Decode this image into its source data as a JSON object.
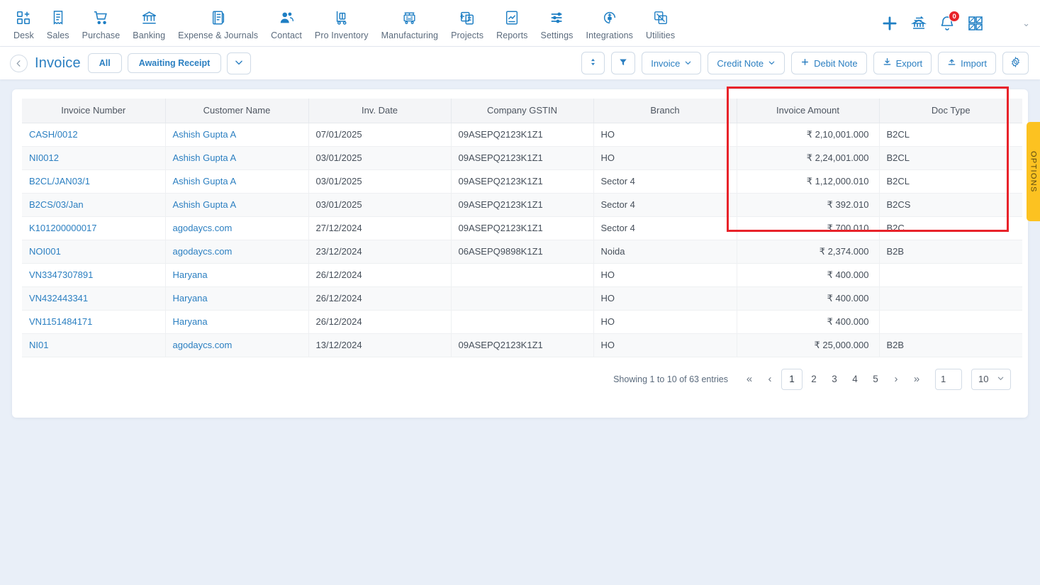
{
  "topnav": {
    "modules": [
      {
        "label": "Desk",
        "icon": "dashboard-grid-plus-icon"
      },
      {
        "label": "Sales",
        "icon": "receipt-icon"
      },
      {
        "label": "Purchase",
        "icon": "shopping-cart-icon"
      },
      {
        "label": "Banking",
        "icon": "bank-building-icon"
      },
      {
        "label": "Expense & Journals",
        "icon": "ledger-book-icon"
      },
      {
        "label": "Contact",
        "icon": "people-icon"
      },
      {
        "label": "Pro Inventory",
        "icon": "hand-truck-icon"
      },
      {
        "label": "Manufacturing",
        "icon": "factory-machine-icon"
      },
      {
        "label": "Projects",
        "icon": "project-clipboard-icon"
      },
      {
        "label": "Reports",
        "icon": "report-chart-icon"
      },
      {
        "label": "Settings",
        "icon": "sliders-icon"
      },
      {
        "label": "Integrations",
        "icon": "plug-circle-icon"
      },
      {
        "label": "Utilities",
        "icon": "utilities-swap-icon"
      }
    ],
    "actions": {
      "add": "add-plus-icon",
      "bank_transfer": "bank-transfer-icon",
      "notifications": "bell-icon",
      "notification_count": "0",
      "apps": "apps-grid-icon",
      "user_caret": "chevron-down-icon"
    }
  },
  "subheader": {
    "back": "chevron-left-icon",
    "title": "Invoice",
    "filter_all": "All",
    "filter_awaiting": "Awaiting Receipt",
    "filter_more": "chevron-down-icon",
    "sort_icon": "sort-updown-icon",
    "filter_icon": "funnel-icon",
    "invoice_dropdown": "Invoice",
    "credit_note_dropdown": "Credit Note",
    "debit_note": "Debit Note",
    "export": "Export",
    "import": "Import",
    "settings_icon": "gear-icon"
  },
  "table": {
    "columns": [
      "Invoice Number",
      "Customer Name",
      "Inv. Date",
      "Company GSTIN",
      "Branch",
      "Invoice Amount",
      "Doc Type"
    ],
    "rows": [
      {
        "invoice_number": "CASH/0012",
        "customer_name": "Ashish Gupta A",
        "inv_date": "07/01/2025",
        "company_gstin": "09ASEPQ2123K1Z1",
        "branch": "HO",
        "invoice_amount": "₹ 2,10,001.000",
        "doc_type": "B2CL"
      },
      {
        "invoice_number": "NI0012",
        "customer_name": "Ashish Gupta A",
        "inv_date": "03/01/2025",
        "company_gstin": "09ASEPQ2123K1Z1",
        "branch": "HO",
        "invoice_amount": "₹ 2,24,001.000",
        "doc_type": "B2CL"
      },
      {
        "invoice_number": "B2CL/JAN03/1",
        "customer_name": "Ashish Gupta A",
        "inv_date": "03/01/2025",
        "company_gstin": "09ASEPQ2123K1Z1",
        "branch": "Sector 4",
        "invoice_amount": "₹ 1,12,000.010",
        "doc_type": "B2CL"
      },
      {
        "invoice_number": "B2CS/03/Jan",
        "customer_name": "Ashish Gupta A",
        "inv_date": "03/01/2025",
        "company_gstin": "09ASEPQ2123K1Z1",
        "branch": "Sector 4",
        "invoice_amount": "₹ 392.010",
        "doc_type": "B2CS"
      },
      {
        "invoice_number": "K101200000017",
        "customer_name": "agodaycs.com",
        "inv_date": "27/12/2024",
        "company_gstin": "09ASEPQ2123K1Z1",
        "branch": "Sector 4",
        "invoice_amount": "₹ 700.010",
        "doc_type": "B2C"
      },
      {
        "invoice_number": "NOI001",
        "customer_name": "agodaycs.com",
        "inv_date": "23/12/2024",
        "company_gstin": "06ASEPQ9898K1Z1",
        "branch": "Noida",
        "invoice_amount": "₹ 2,374.000",
        "doc_type": "B2B"
      },
      {
        "invoice_number": "VN3347307891",
        "customer_name": "Haryana",
        "inv_date": "26/12/2024",
        "company_gstin": "",
        "branch": "HO",
        "invoice_amount": "₹ 400.000",
        "doc_type": ""
      },
      {
        "invoice_number": "VN432443341",
        "customer_name": "Haryana",
        "inv_date": "26/12/2024",
        "company_gstin": "",
        "branch": "HO",
        "invoice_amount": "₹ 400.000",
        "doc_type": ""
      },
      {
        "invoice_number": "VN1151484171",
        "customer_name": "Haryana",
        "inv_date": "26/12/2024",
        "company_gstin": "",
        "branch": "HO",
        "invoice_amount": "₹ 400.000",
        "doc_type": ""
      },
      {
        "invoice_number": "NI01",
        "customer_name": "agodaycs.com",
        "inv_date": "13/12/2024",
        "company_gstin": "09ASEPQ2123K1Z1",
        "branch": "HO",
        "invoice_amount": "₹ 25,000.000",
        "doc_type": "B2B"
      }
    ]
  },
  "pagination": {
    "showing": "Showing 1 to 10 of 63 entries",
    "first": "«",
    "prev": "‹",
    "pages": [
      "1",
      "2",
      "3",
      "4",
      "5"
    ],
    "active_page": "1",
    "next": "›",
    "last": "»",
    "goto_value": "1",
    "page_size": "10",
    "page_size_caret": "chevron-down-icon"
  },
  "options_tab": {
    "label": "OPTIONS"
  },
  "colors": {
    "accent": "#2b7fc1",
    "highlight_box": "#e8232a",
    "options_tab": "#fcc221",
    "page_background": "#e9eff8"
  }
}
